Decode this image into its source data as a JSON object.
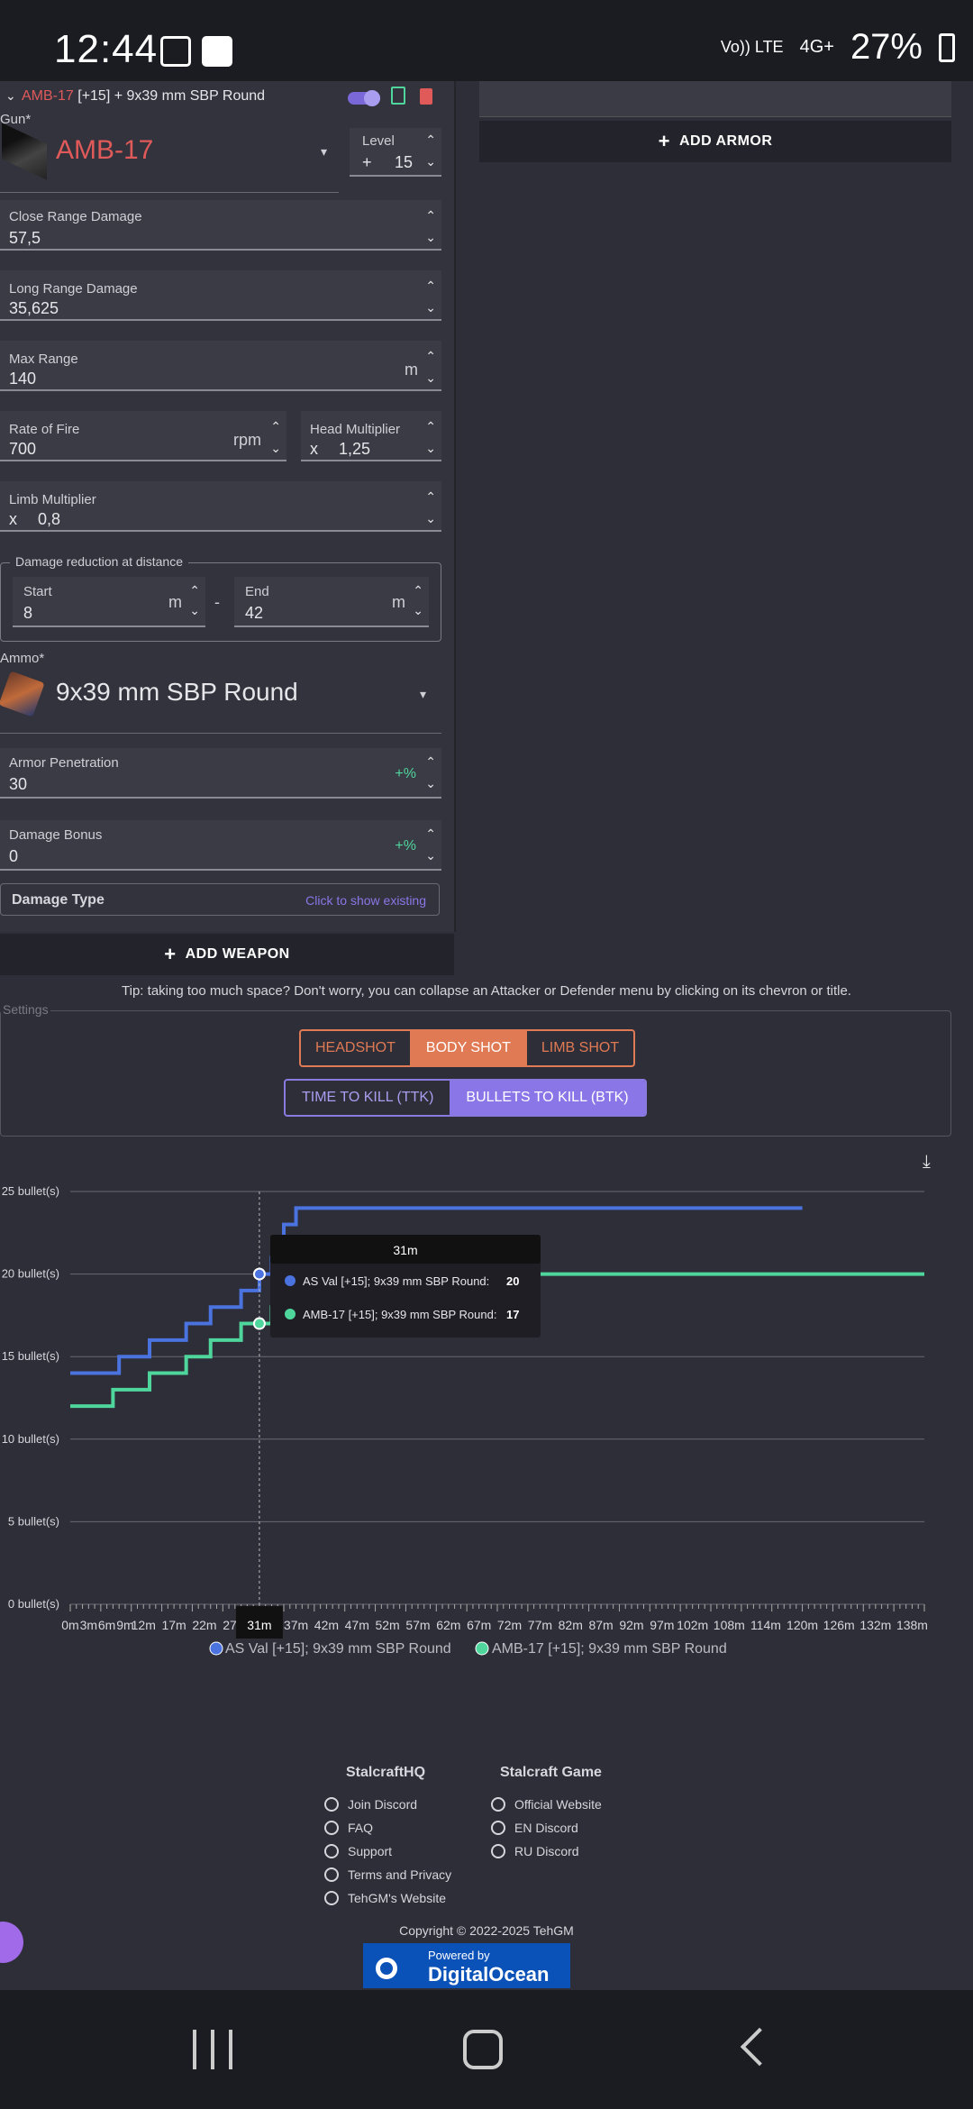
{
  "status": {
    "time": "12:44",
    "network": "Vo)) LTE",
    "signal_type": "4G+",
    "battery": "27%"
  },
  "weapon": {
    "header_title_gun": "AMB-17",
    "header_title_rest": " [+15] + 9x39 mm SBP Round",
    "gun_label": "Gun*",
    "gun_name": "AMB-17",
    "level_label": "Level",
    "level_value": "15",
    "level_prefix": "+",
    "close_range_label": "Close Range Damage",
    "close_range_value": "57,5",
    "long_range_label": "Long Range Damage",
    "long_range_value": "35,625",
    "max_range_label": "Max Range",
    "max_range_value": "140",
    "max_range_unit": "m",
    "rof_label": "Rate of Fire",
    "rof_value": "700",
    "rof_unit": "rpm",
    "head_mult_label": "Head Multiplier",
    "head_mult_prefix": "x",
    "head_mult_value": "1,25",
    "limb_mult_label": "Limb Multiplier",
    "limb_mult_prefix": "x",
    "limb_mult_value": "0,8",
    "reduction_legend": "Damage reduction at distance",
    "start_label": "Start",
    "start_value": "8",
    "start_unit": "m",
    "end_label": "End",
    "end_value": "42",
    "end_unit": "m",
    "range_sep": "-",
    "ammo_label": "Ammo*",
    "ammo_name": "9x39 mm SBP Round",
    "armor_pen_label": "Armor Penetration",
    "armor_pen_value": "30",
    "armor_pen_unit": "+%",
    "dmg_bonus_label": "Damage Bonus",
    "dmg_bonus_value": "0",
    "dmg_bonus_unit": "+%",
    "damage_type_label": "Damage Type",
    "damage_type_link": "Click to show existing"
  },
  "buttons": {
    "add_weapon": "ADD WEAPON",
    "add_armor": "ADD ARMOR"
  },
  "tip": "Tip: taking too much space? Don't worry, you can collapse an Attacker or Defender menu by clicking on its chevron or title.",
  "settings": {
    "legend": "Settings",
    "shot_options": [
      "HEADSHOT",
      "BODY SHOT",
      "LIMB SHOT"
    ],
    "shot_selected": "BODY SHOT",
    "metric_options": [
      "TIME TO KILL (TTK)",
      "BULLETS TO KILL (BTK)"
    ],
    "metric_selected": "BULLETS TO KILL (BTK)"
  },
  "chart_data": {
    "type": "line",
    "ylabel_ticks": [
      "0 bullet(s)",
      "5 bullet(s)",
      "10 bullet(s)",
      "15 bullet(s)",
      "20 bullet(s)",
      "25 bullet(s)"
    ],
    "ylim": [
      0,
      25
    ],
    "x_ticks": [
      "0m",
      "3m",
      "6m",
      "9m",
      "12m",
      "17m",
      "22m",
      "27m",
      "31m",
      "37m",
      "42m",
      "47m",
      "52m",
      "57m",
      "62m",
      "67m",
      "72m",
      "77m",
      "82m",
      "87m",
      "92m",
      "97m",
      "102m",
      "108m",
      "114m",
      "120m",
      "126m",
      "132m",
      "138m"
    ],
    "xlim": [
      0,
      140
    ],
    "series": [
      {
        "name": "AS Val [+15]; 9x39 mm SBP Round",
        "color": "#4a73e0",
        "x": [
          0,
          7,
          8,
          10,
          13,
          16,
          19,
          21,
          23,
          26,
          28,
          31,
          33,
          34,
          35,
          37,
          120
        ],
        "y": [
          14,
          14,
          15,
          15,
          16,
          16,
          17,
          17,
          18,
          18,
          19,
          20,
          21,
          22,
          23,
          24,
          24
        ]
      },
      {
        "name": "AMB-17 [+15]; 9x39 mm SBP Round",
        "color": "#4fd69c",
        "x": [
          0,
          6,
          7,
          12,
          13,
          16,
          19,
          21,
          23,
          26,
          28,
          31,
          33,
          35,
          36,
          140
        ],
        "y": [
          12,
          12,
          13,
          13,
          14,
          14,
          15,
          15,
          16,
          16,
          17,
          17,
          18,
          19,
          20,
          20
        ]
      }
    ],
    "tooltip": {
      "x_label": "31m",
      "rows": [
        {
          "name": "AS Val [+15]; 9x39 mm SBP Round",
          "value": "20"
        },
        {
          "name": "AMB-17 [+15]; 9x39 mm SBP Round",
          "value": "17"
        }
      ]
    },
    "crosshair_label": "31m",
    "legend_position": "bottom"
  },
  "footer": {
    "col1_title": "StalcraftHQ",
    "col1_links": [
      "Join Discord",
      "FAQ",
      "Support",
      "Terms and Privacy",
      "TehGM's Website"
    ],
    "col2_title": "Stalcraft Game",
    "col2_links": [
      "Official Website",
      "EN Discord",
      "RU Discord"
    ],
    "copyright": "Copyright © 2022-2025 TehGM",
    "sponsor_top": "Powered by",
    "sponsor_name": "DigitalOcean"
  }
}
